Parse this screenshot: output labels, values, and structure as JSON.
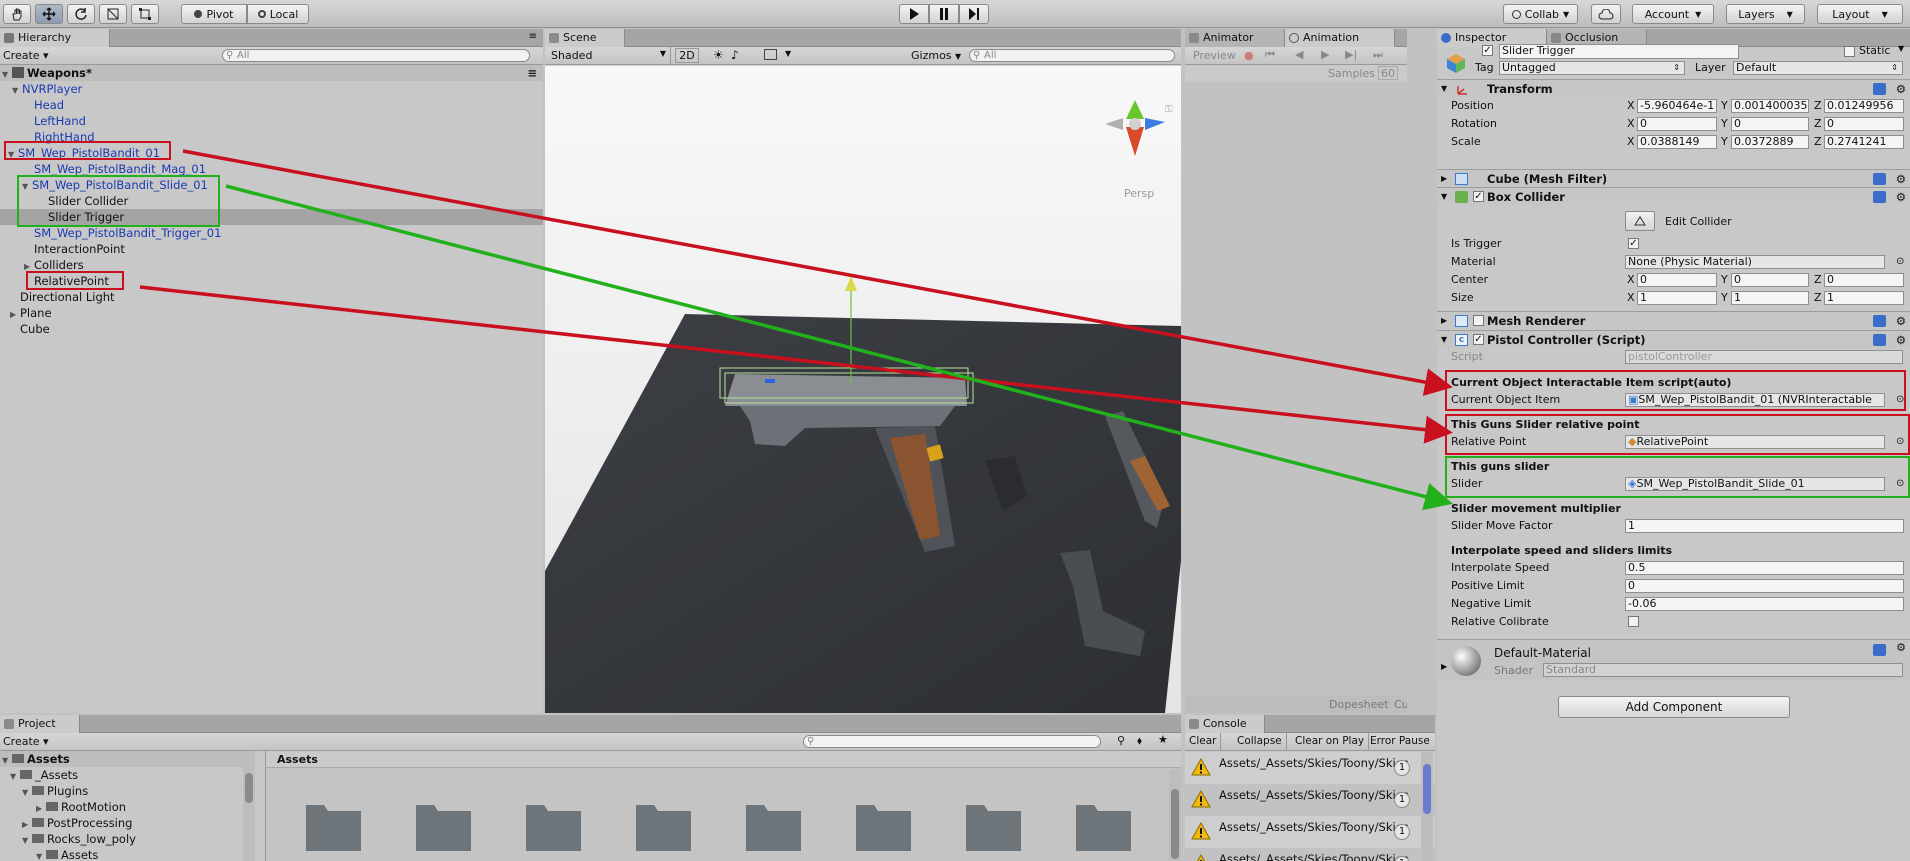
{
  "toolbar": {
    "pivot": "Pivot",
    "local": "Local",
    "collab": "Collab",
    "account": "Account",
    "layers": "Layers",
    "layout": "Layout"
  },
  "hierarchy": {
    "tab": "Hierarchy",
    "create": "Create",
    "search_placeholder": "All",
    "scene_name": "Weapons*",
    "items": [
      "NVRPlayer",
      "Head",
      "LeftHand",
      "RightHand",
      "SM_Wep_PistolBandit_01",
      "SM_Wep_PistolBandit_Mag_01",
      "SM_Wep_PistolBandit_Slide_01",
      "Slider Collider",
      "Slider Trigger",
      "SM_Wep_PistolBandit_Trigger_01",
      "InteractionPoint",
      "Colliders",
      "RelativePoint",
      "Directional Light",
      "Plane",
      "Cube"
    ]
  },
  "scene": {
    "tab": "Scene",
    "shading": "Shaded",
    "mode_2d": "2D",
    "gizmos": "Gizmos",
    "search_placeholder": "All",
    "persp": "Persp"
  },
  "animator": {
    "tab_animator": "Animator",
    "tab_animation": "Animation",
    "preview": "Preview",
    "samples_label": "Samples",
    "samples_value": "60",
    "dopesheet": "Dopesheet",
    "curves": "Cu"
  },
  "inspector": {
    "tab_inspector": "Inspector",
    "tab_occlusion": "Occlusion",
    "object_name": "Slider Trigger",
    "static_label": "Static",
    "tag_label": "Tag",
    "tag_value": "Untagged",
    "layer_label": "Layer",
    "layer_value": "Default",
    "transform": {
      "title": "Transform",
      "position_label": "Position",
      "rotation_label": "Rotation",
      "scale_label": "Scale",
      "position": [
        "-5.960464e-1",
        "0.001400035",
        "0.01249956"
      ],
      "rotation": [
        "0",
        "0",
        "0"
      ],
      "scale": [
        "0.0388149",
        "0.0372889",
        "0.2741241"
      ]
    },
    "mesh_filter": "Cube (Mesh Filter)",
    "box_collider": {
      "title": "Box Collider",
      "edit": "Edit Collider",
      "is_trigger": "Is Trigger",
      "material_label": "Material",
      "material_value": "None (Physic Material)",
      "center_label": "Center",
      "center": [
        "0",
        "0",
        "0"
      ],
      "size_label": "Size",
      "size": [
        "1",
        "1",
        "1"
      ]
    },
    "mesh_renderer": "Mesh Renderer",
    "pistol": {
      "title": "Pistol Controller (Script)",
      "script_label": "Script",
      "script_value": "pistolController",
      "h1": "Current Object Interactable Item script(auto)",
      "current_label": "Current Object Item",
      "current_value": "SM_Wep_PistolBandit_01 (NVRInteractable",
      "h2": "This Guns Slider relative point",
      "relative_label": "Relative Point",
      "relative_value": "RelativePoint",
      "h3": "This guns slider",
      "slider_label": "Slider",
      "slider_value": "SM_Wep_PistolBandit_Slide_01",
      "h4": "Slider movement multiplier",
      "move_label": "Slider Move Factor",
      "move_value": "1",
      "h5": "Interpolate speed and sliders limits",
      "interp_label": "Interpolate Speed",
      "interp_value": "0.5",
      "pos_limit_label": "Positive Limit",
      "pos_limit_value": "0",
      "neg_limit_label": "Negative Limit",
      "neg_limit_value": "-0.06",
      "calib_label": "Relative Colibrate"
    },
    "material": {
      "name": "Default-Material",
      "shader_label": "Shader",
      "shader_value": "Standard"
    },
    "add_component": "Add Component"
  },
  "project": {
    "tab": "Project",
    "create": "Create",
    "tree": [
      "Assets",
      "_Assets",
      "Plugins",
      "RootMotion",
      "PostProcessing",
      "Rocks_low_poly",
      "Assets"
    ],
    "breadcrumb": "Assets"
  },
  "console": {
    "tab": "Console",
    "clear": "Clear",
    "collapse": "Collapse",
    "clear_on_play": "Clear on Play",
    "error_pause": "Error Pause",
    "rows": [
      {
        "text": "Assets/_Assets/Skies/Toony/Skies",
        "count": "1"
      },
      {
        "text": "Assets/_Assets/Skies/Toony/Skies",
        "count": "1"
      },
      {
        "text": "Assets/_Assets/Skies/Toony/Skies",
        "count": "1"
      },
      {
        "text": "Assets/_Assets/Skies/Toony/Skies",
        "count": "1"
      }
    ]
  },
  "colors": {
    "annotation_red": "#c8101e",
    "annotation_green": "#22b11c",
    "hierarchy_link_blue": "#1a3ab0",
    "selection_gray": "#a4a4a4"
  }
}
